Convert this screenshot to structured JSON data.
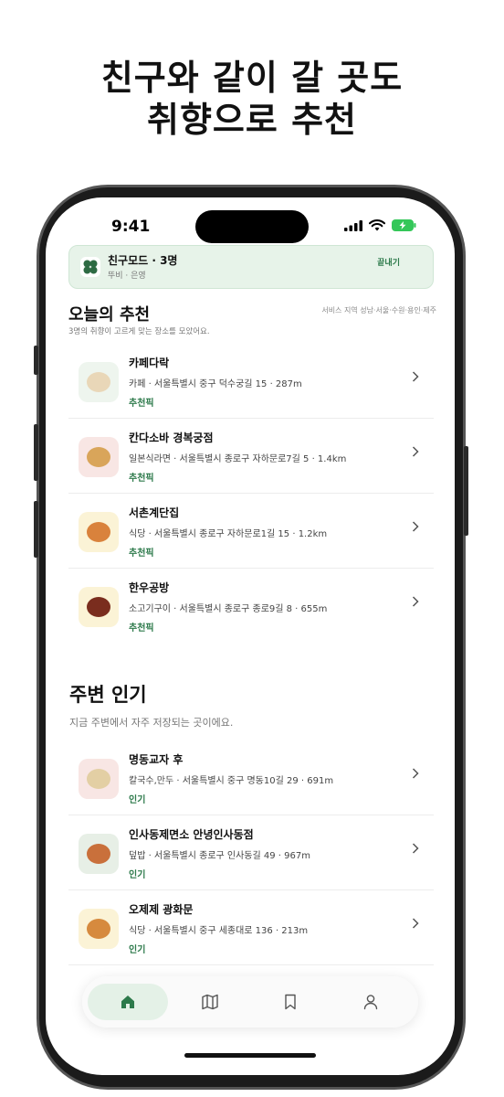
{
  "headline": {
    "line1": "친구와 같이 갈 곳도",
    "line2": "취향으로 추천"
  },
  "status_bar": {
    "time": "9:41"
  },
  "friend_mode": {
    "title": "친구모드 · 3명",
    "members": "뚜비 · 은영",
    "end_label": "끝내기"
  },
  "today": {
    "title": "오늘의 추천",
    "subtitle": "3명의 취향이 고르게 맞는 장소를 모았어요.",
    "region": "서비스 지역 성남·서울·수원·용인·제주",
    "items": [
      {
        "name": "카페다락",
        "meta": "카페 · 서울특별시 중구 덕수궁길 15 · 287m",
        "tag": "추천픽",
        "thumb_color": "#eef5ee",
        "dish_color": "#e9d7b8"
      },
      {
        "name": "칸다소바 경복궁점",
        "meta": "일본식라면 · 서울특별시 종로구 자하문로7길 5 · 1.4km",
        "tag": "추천픽",
        "thumb_color": "#f8e6e4",
        "dish_color": "#d9a55a"
      },
      {
        "name": "서촌계단집",
        "meta": "식당 · 서울특별시 종로구 자하문로1길 15 · 1.2km",
        "tag": "추천픽",
        "thumb_color": "#fbf3d6",
        "dish_color": "#d9823c"
      },
      {
        "name": "한우공방",
        "meta": "소고기구이 · 서울특별시 종로구 종로9길 8 · 655m",
        "tag": "추천픽",
        "thumb_color": "#fbf3d6",
        "dish_color": "#7a2d1e"
      }
    ]
  },
  "nearby": {
    "title": "주변 인기",
    "subtitle": "지금 주변에서 자주 저장되는 곳이에요.",
    "items": [
      {
        "name": "명동교자 후",
        "meta": "칼국수,만두 · 서울특별시 중구 명동10길 29 · 691m",
        "tag": "인기",
        "thumb_color": "#f8e6e4",
        "dish_color": "#e3cfa4"
      },
      {
        "name": "인사동제면소 안녕인사동점",
        "meta": "덮밥 · 서울특별시 종로구 인사동길 49 · 967m",
        "tag": "인기",
        "thumb_color": "#e7efe6",
        "dish_color": "#c9703b"
      },
      {
        "name": "오제제 광화문",
        "meta": "식당 · 서울특별시 중구 세종대로 136 · 213m",
        "tag": "인기",
        "thumb_color": "#fbf3d6",
        "dish_color": "#d68a3e"
      }
    ]
  },
  "tabbar": {
    "tabs": [
      {
        "icon": "home-icon",
        "active": true
      },
      {
        "icon": "map-icon",
        "active": false
      },
      {
        "icon": "bookmark-icon",
        "active": false
      },
      {
        "icon": "profile-icon",
        "active": false
      }
    ]
  },
  "colors": {
    "accent": "#2d7a4b",
    "friend_card_bg": "#e7f3e9"
  }
}
